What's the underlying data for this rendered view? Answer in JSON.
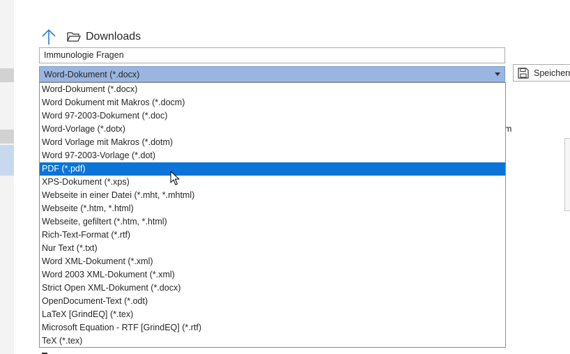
{
  "location": {
    "folder_name": "Downloads"
  },
  "filename": {
    "value": "Immunologie Fragen"
  },
  "file_type": {
    "selected": "Word-Dokument (*.docx)",
    "options": [
      "Word-Dokument (*.docx)",
      "Word Dokument mit Makros (*.docm)",
      "Word 97-2003-Dokument (*.doc)",
      "Word-Vorlage (*.dotx)",
      "Word Vorlage mit Makros (*.dotm)",
      "Word 97-2003-Vorlage (*.dot)",
      "PDF (*.pdf)",
      "XPS-Dokument (*.xps)",
      "Webseite in einer Datei (*.mht, *.mhtml)",
      "Webseite (*.htm, *.html)",
      "Webseite, gefiltert (*.htm, *.html)",
      "Rich-Text-Format (*.rtf)",
      "Nur Text (*.txt)",
      "Word XML-Dokument (*.xml)",
      "Word 2003 XML-Dokument (*.xml)",
      "Strict Open XML-Dokument (*.docx)",
      "OpenDocument-Text (*.odt)",
      "LaTeX [GrindEQ] (*.tex)",
      "Microsoft Equation - RTF [GrindEQ] (*.rtf)",
      "TeX (*.tex)"
    ],
    "highlighted_index": 6
  },
  "save_button": {
    "label": "Speichern"
  },
  "background_fragment": {
    "text": "m"
  },
  "colors": {
    "highlight": "#0a74d8",
    "select_background": "#9ab6e0",
    "up_arrow": "#2b7fd4"
  },
  "icons": {
    "up": "up-arrow-icon",
    "folder": "folder-open-icon",
    "caret": "chevron-down-icon",
    "save": "save-icon",
    "cursor": "mouse-pointer-icon"
  }
}
